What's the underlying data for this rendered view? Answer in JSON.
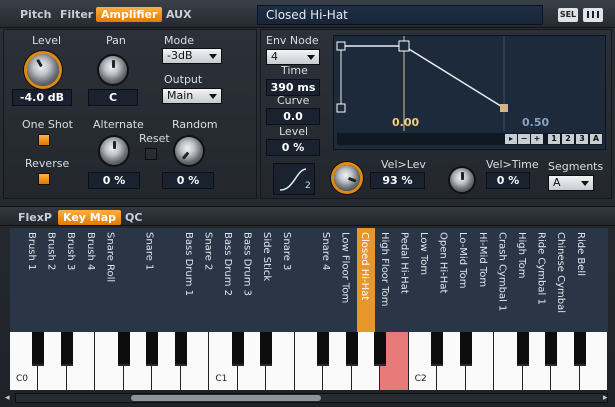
{
  "top_tabs": [
    "Pitch",
    "Filter",
    "Amplifier",
    "AUX"
  ],
  "preset_name": "Closed Hi-Hat",
  "top_buttons": {
    "sel": "SEL"
  },
  "amp": {
    "level_label": "Level",
    "level_value": "-4.0 dB",
    "pan_label": "Pan",
    "pan_value": "C",
    "mode_label": "Mode",
    "mode_value": "-3dB",
    "output_label": "Output",
    "output_value": "Main",
    "oneshot_label": "One Shot",
    "alternate_label": "Alternate",
    "alternate_value": "0 %",
    "reset_label": "Reset",
    "random_label": "Random",
    "random_value": "0 %",
    "reverse_label": "Reverse"
  },
  "env": {
    "envnode_label": "Env Node",
    "envnode_value": "4",
    "time_label": "Time",
    "time_value": "390 ms",
    "curve_label": "Curve",
    "curve_value": "0.0",
    "level_label": "Level",
    "level_value": "0 %",
    "marker_left": "0.00",
    "marker_right": "0.50",
    "buttons": [
      "1",
      "2",
      "3",
      "A"
    ],
    "curve_num": "2"
  },
  "vel": {
    "lev_label": "Vel>Lev",
    "lev_value": "93 %",
    "time_label": "Vel>Time",
    "time_value": "0 %",
    "segments_label": "Segments",
    "segments_value": "A"
  },
  "bottom_tabs": [
    "FlexP",
    "Key Map",
    "QC"
  ],
  "keymap_columns": [
    "Brush 1",
    "Brush 2",
    "Brush 3",
    "Brush 4",
    "Snare Roll",
    "",
    "Snare 1",
    "",
    "Bass Drum 1",
    "Snare 2",
    "Bass Drum 2",
    "Bass Drum 3",
    "Side Stick",
    "Snare 3",
    "",
    "Snare 4",
    "Low Floor Tom",
    "Closed Hi-Hat",
    "High Floor Tom",
    "Pedal Hi-Hat",
    "Low Tom",
    "Open Hi-Hat",
    "Lo-Mid Tom",
    "Hi-Mid Tom",
    "Crash Cymbal 1",
    "High Tom",
    "Ride Cymbal 1",
    "Chinese Cymbal",
    "Ride Bell"
  ],
  "selected_column": "Closed Hi-Hat",
  "octave_labels": [
    "C0",
    "C1",
    "C2"
  ],
  "accent": "#e8952a"
}
